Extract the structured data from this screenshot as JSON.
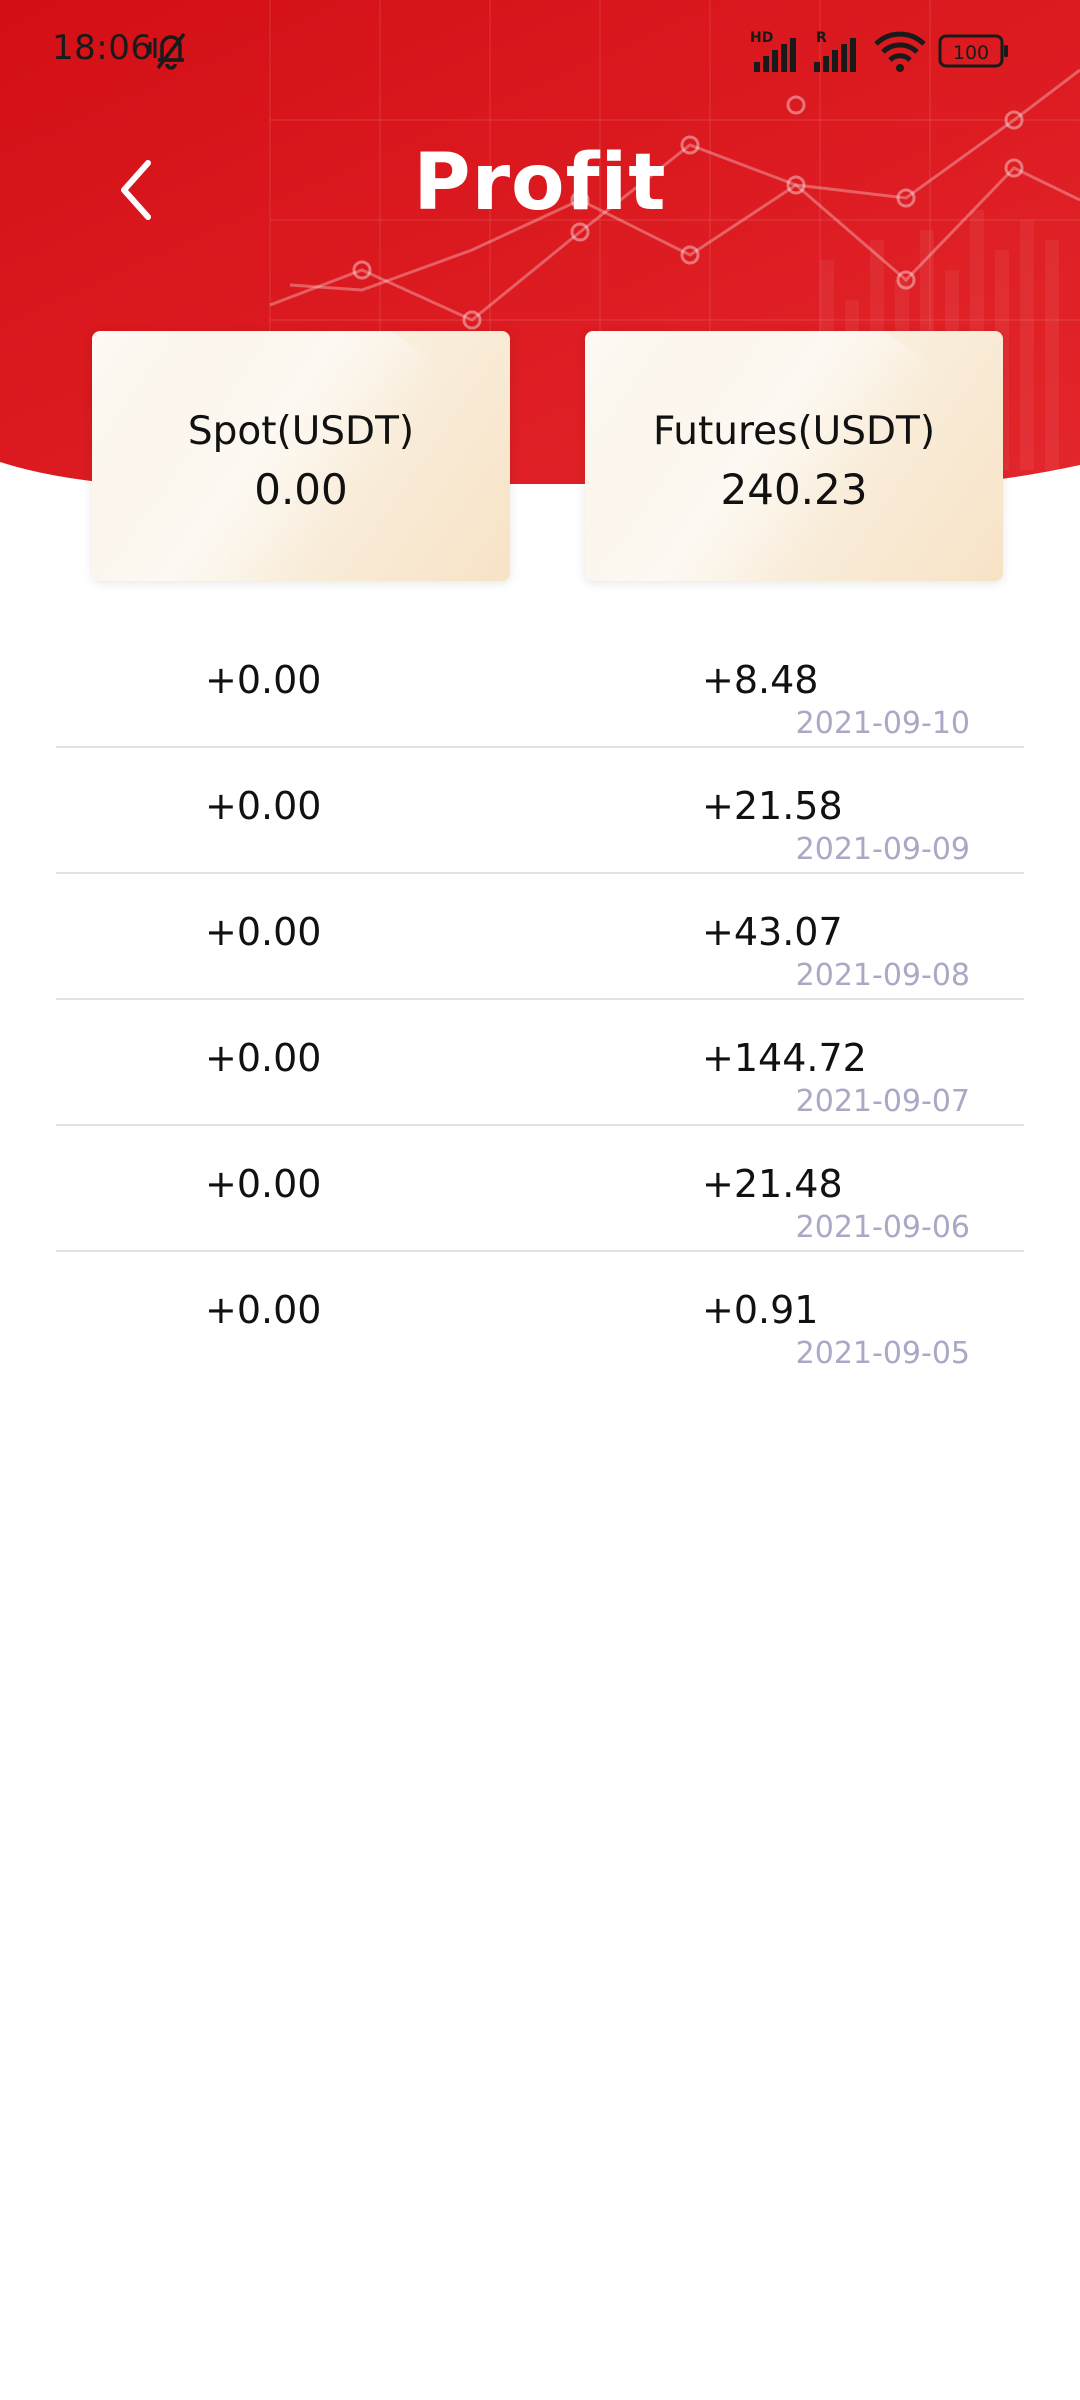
{
  "status_bar": {
    "time": "18:06",
    "mute_icon": "bell-muted-icon",
    "network_hd_label": "HD",
    "network_r_label": "R",
    "battery_level": "100"
  },
  "header": {
    "title": "Profit",
    "back_icon": "chevron-left-icon"
  },
  "colors": {
    "header_red": "#d8131b",
    "card_cream": "#faf1e2",
    "date_gray": "#a9a9c5",
    "divider": "#e2e2e6"
  },
  "summary": {
    "spot": {
      "label": "Spot(USDT)",
      "value": "0.00"
    },
    "futures": {
      "label": "Futures(USDT)",
      "value": "240.23"
    }
  },
  "records": [
    {
      "spot": "+0.00",
      "futures": "+8.48",
      "date": "2021-09-10"
    },
    {
      "spot": "+0.00",
      "futures": "+21.58",
      "date": "2021-09-09"
    },
    {
      "spot": "+0.00",
      "futures": "+43.07",
      "date": "2021-09-08"
    },
    {
      "spot": "+0.00",
      "futures": "+144.72",
      "date": "2021-09-07"
    },
    {
      "spot": "+0.00",
      "futures": "+21.48",
      "date": "2021-09-06"
    },
    {
      "spot": "+0.00",
      "futures": "+0.91",
      "date": "2021-09-05"
    }
  ]
}
